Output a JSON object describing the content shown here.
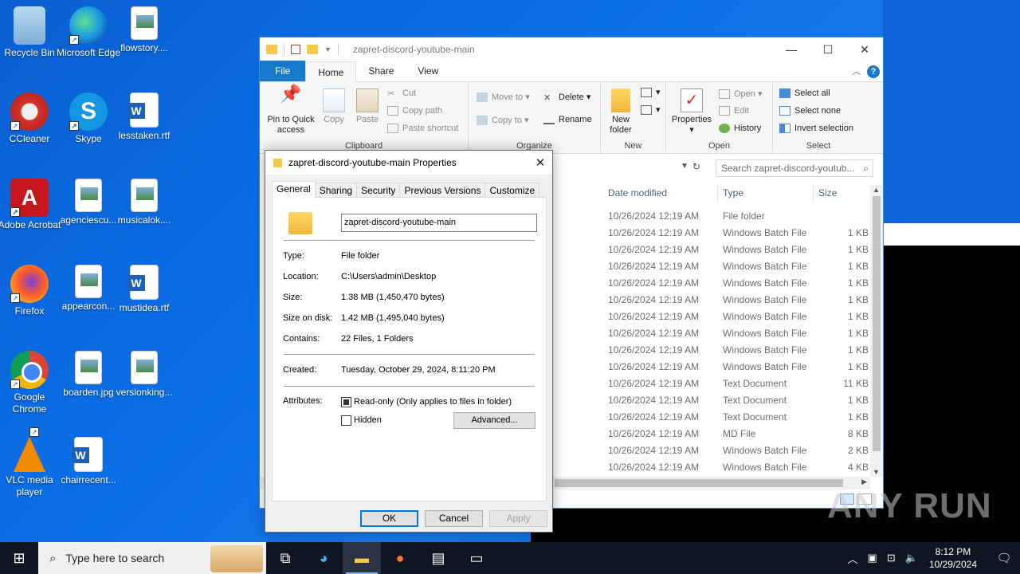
{
  "desktop": {
    "icons": [
      {
        "label": "Recycle Bin",
        "icon": "recycle-bin-icon"
      },
      {
        "label": "Microsoft Edge",
        "icon": "edge-icon"
      },
      {
        "label": "flowstory....",
        "icon": "image-file-icon"
      },
      {
        "label": "CCleaner",
        "icon": "ccleaner-icon"
      },
      {
        "label": "Skype",
        "icon": "skype-icon"
      },
      {
        "label": "lesstaken.rtf",
        "icon": "word-doc-icon"
      },
      {
        "label": "Adobe Acrobat",
        "icon": "acrobat-icon"
      },
      {
        "label": "agenciescu...",
        "icon": "image-file-icon"
      },
      {
        "label": "musicalok....",
        "icon": "image-file-icon"
      },
      {
        "label": "Firefox",
        "icon": "firefox-icon"
      },
      {
        "label": "appearcon...",
        "icon": "image-file-icon"
      },
      {
        "label": "mustidea.rtf",
        "icon": "word-doc-icon"
      },
      {
        "label": "Google Chrome",
        "icon": "chrome-icon"
      },
      {
        "label": "boarden.jpg",
        "icon": "image-file-icon"
      },
      {
        "label": "versionking...",
        "icon": "image-file-icon"
      },
      {
        "label": "VLC media player",
        "icon": "vlc-icon"
      },
      {
        "label": "chairrecent...",
        "icon": "word-doc-icon"
      }
    ]
  },
  "explorer": {
    "title": "zapret-discord-youtube-main",
    "tabs": {
      "file": "File",
      "home": "Home",
      "share": "Share",
      "view": "View"
    },
    "ribbon": {
      "pin": "Pin to Quick access",
      "copy": "Copy",
      "paste": "Paste",
      "cut": "Cut",
      "copy_path": "Copy path",
      "paste_shortcut": "Paste shortcut",
      "clipboard": "Clipboard",
      "move_to": "Move to",
      "copy_to": "Copy to",
      "delete": "Delete",
      "rename": "Rename",
      "organize": "Organize",
      "new_folder": "New folder",
      "new": "New",
      "properties": "Properties",
      "open": "Open",
      "edit": "Edit",
      "history": "History",
      "open_group": "Open",
      "select_all": "Select all",
      "select_none": "Select none",
      "invert_selection": "Invert selection",
      "select": "Select"
    },
    "search_placeholder": "Search zapret-discord-youtub...",
    "columns": {
      "date": "Date modified",
      "type": "Type",
      "size": "Size"
    },
    "rows": [
      {
        "date": "10/26/2024 12:19 AM",
        "type": "File folder",
        "size": ""
      },
      {
        "date": "10/26/2024 12:19 AM",
        "type": "Windows Batch File",
        "size": "1 KB"
      },
      {
        "date": "10/26/2024 12:19 AM",
        "type": "Windows Batch File",
        "size": "1 KB"
      },
      {
        "date": "10/26/2024 12:19 AM",
        "type": "Windows Batch File",
        "size": "1 KB"
      },
      {
        "date": "10/26/2024 12:19 AM",
        "type": "Windows Batch File",
        "size": "1 KB"
      },
      {
        "date": "10/26/2024 12:19 AM",
        "type": "Windows Batch File",
        "size": "1 KB"
      },
      {
        "date": "10/26/2024 12:19 AM",
        "type": "Windows Batch File",
        "size": "1 KB"
      },
      {
        "date": "10/26/2024 12:19 AM",
        "type": "Windows Batch File",
        "size": "1 KB"
      },
      {
        "date": "10/26/2024 12:19 AM",
        "type": "Windows Batch File",
        "size": "1 KB"
      },
      {
        "date": "10/26/2024 12:19 AM",
        "type": "Windows Batch File",
        "size": "1 KB"
      },
      {
        "date": "10/26/2024 12:19 AM",
        "type": "Text Document",
        "size": "11 KB"
      },
      {
        "date": "10/26/2024 12:19 AM",
        "type": "Text Document",
        "size": "1 KB"
      },
      {
        "date": "10/26/2024 12:19 AM",
        "type": "Text Document",
        "size": "1 KB"
      },
      {
        "date": "10/26/2024 12:19 AM",
        "type": "MD File",
        "size": "8 KB"
      },
      {
        "date": "10/26/2024 12:19 AM",
        "type": "Windows Batch File",
        "size": "2 KB"
      },
      {
        "date": "10/26/2024 12:19 AM",
        "type": "Windows Batch File",
        "size": "4 KB"
      }
    ]
  },
  "dialog": {
    "title": "zapret-discord-youtube-main Properties",
    "tabs": [
      "General",
      "Sharing",
      "Security",
      "Previous Versions",
      "Customize"
    ],
    "name": "zapret-discord-youtube-main",
    "type_label": "Type:",
    "type_value": "File folder",
    "location_label": "Location:",
    "location_value": "C:\\Users\\admin\\Desktop",
    "size_label": "Size:",
    "size_value": "1.38 MB (1,450,470 bytes)",
    "disk_label": "Size on disk:",
    "disk_value": "1.42 MB (1,495,040 bytes)",
    "contains_label": "Contains:",
    "contains_value": "22 Files, 1 Folders",
    "created_label": "Created:",
    "created_value": "Tuesday, October 29, 2024, 8:11:20 PM",
    "attributes_label": "Attributes:",
    "readonly_label": "Read-only (Only applies to files in folder)",
    "hidden_label": "Hidden",
    "advanced": "Advanced...",
    "ok": "OK",
    "cancel": "Cancel",
    "apply": "Apply"
  },
  "taskbar": {
    "search_placeholder": "Type here to search",
    "time": "8:12 PM",
    "date": "10/29/2024"
  },
  "watermark": "ANY RUN"
}
